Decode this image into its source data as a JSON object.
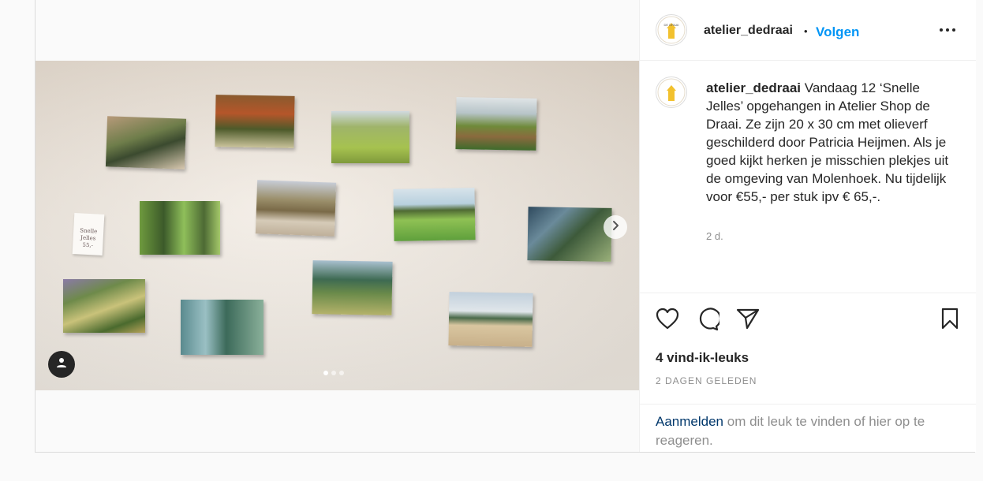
{
  "post": {
    "username": "atelier_dedraai",
    "separator": "•",
    "follow_label": "Volgen",
    "more_icon": "more-horizontal-icon",
    "avatar_text": "DE DRAAI",
    "caption_username": "atelier_dedraai",
    "caption_text": " Vandaag 12 ‘Snelle Jelles’ opgehangen in Atelier Shop de Draai. Ze zijn 20 x 30 cm met olieverf geschilderd door Patricia Heijmen. Als je goed kijkt herken je misschien plekjes uit de omgeving van Molenhoek. Nu tijdelijk voor €55,- per stuk ipv € 65,-.",
    "caption_time": "2 d.",
    "likes": "4 vind-ik-leuks",
    "date": "2 DAGEN GELEDEN",
    "login_link": "Aanmelden",
    "login_rest": " om dit leuk te vinden of hier op te reageren."
  },
  "media": {
    "card_text_line1": "Snelle",
    "card_text_line2": "Jelles",
    "card_text_line3": "55,-",
    "carousel_count": 3,
    "carousel_active": 1
  },
  "icons": {
    "like": "heart-icon",
    "comment": "comment-icon",
    "share": "send-icon",
    "save": "bookmark-icon",
    "next": "chevron-right-icon",
    "tag": "user-tag-icon"
  },
  "colors": {
    "accent": "#0095f6",
    "link_dark": "#00376b",
    "muted": "#8e8e8e",
    "text": "#262626"
  }
}
